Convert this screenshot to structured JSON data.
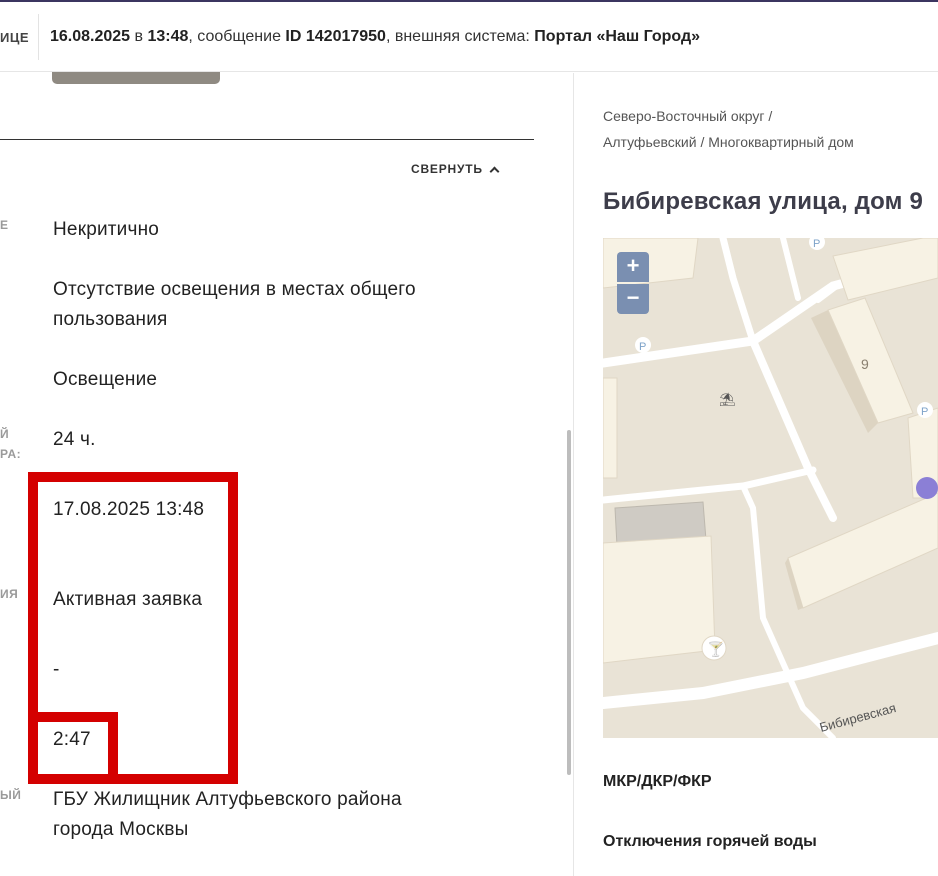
{
  "header": {
    "cut_label": "ИЦЕ",
    "date": "16.08.2025",
    "at": " в ",
    "time": "13:48",
    "message_prefix": ", сообщение ",
    "message_id": "ID 142017950",
    "system_prefix": ", внешняя система: ",
    "system_name": "Портал «Наш Город»"
  },
  "collapse_label": "СВЕРНУТЬ",
  "labels": {
    "l1": "Е",
    "l2a": "Й",
    "l2b": "РА:",
    "l3": "ИЯ",
    "l4": "ЫЙ"
  },
  "details": {
    "criticality": "Некритично",
    "problem_line1": "Отсутствие освещения в местах общего",
    "problem_line2": "пользования",
    "category": "Освещение",
    "deadline": "24 ч.",
    "due_date": "17.08.2025 13:48",
    "status": "Активная заявка",
    "dash": "-",
    "remaining": "2:47",
    "executor_line1": "ГБУ Жилищник Алтуфьевского района",
    "executor_line2": "города Москвы"
  },
  "location": {
    "breadcrumb_line1": "Северо-Восточный округ /",
    "breadcrumb_line2": "Алтуфьевский / Многоквартирный дом",
    "address": "Бибиревская улица, дом 9"
  },
  "map": {
    "zoom_in": "+",
    "zoom_out": "−",
    "building_number": "9",
    "street_label": "Бибиревская",
    "parking_label": "P",
    "colors": {
      "ground": "#e9e3d6",
      "road": "#ffffff",
      "building": "#f7f2e4",
      "building_side": "#ddd4c2",
      "pin": "#8b7fd6",
      "cafe": "#e8742c"
    }
  },
  "sections": {
    "mkr": "МКР/ДКР/ФКР",
    "hot_water": "Отключения горячей воды"
  },
  "colors": {
    "highlight": "#d40000",
    "top_border": "#3b3560"
  }
}
